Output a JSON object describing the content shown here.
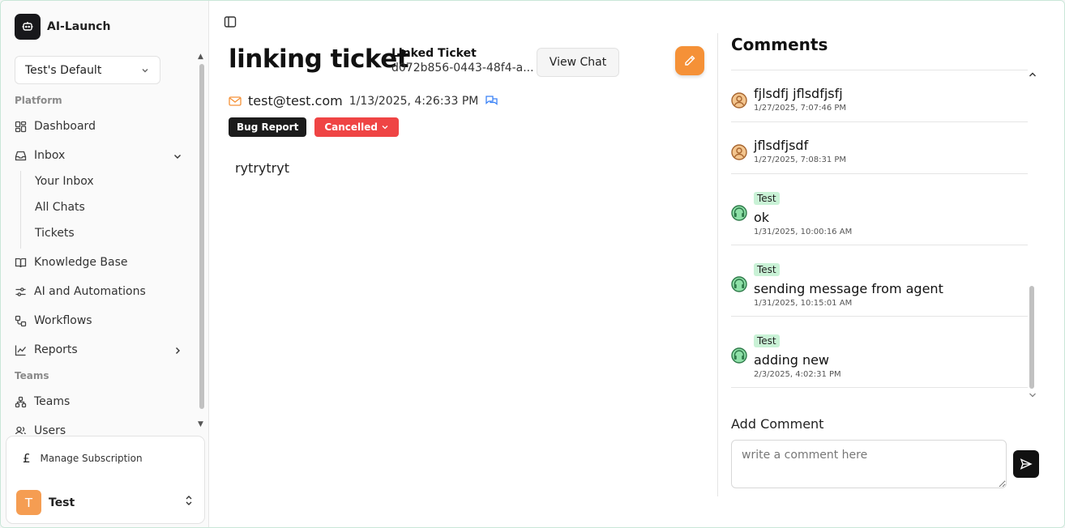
{
  "brand": {
    "name": "AI-Launch"
  },
  "workspace": {
    "label": "Test's Default"
  },
  "sidebar": {
    "platform_label": "Platform",
    "teams_label": "Teams",
    "items": {
      "dashboard": "Dashboard",
      "inbox": "Inbox",
      "your_inbox": "Your Inbox",
      "all_chats": "All Chats",
      "tickets": "Tickets",
      "knowledge_base": "Knowledge Base",
      "ai_automations": "AI and Automations",
      "workflows": "Workflows",
      "reports": "Reports",
      "teams": "Teams",
      "users": "Users"
    }
  },
  "footer": {
    "manage_subscription": "Manage Subscription",
    "user_initial": "T",
    "user_name": "Test"
  },
  "ticket": {
    "title": "linking ticket",
    "linked_label": "Linked Ticket",
    "linked_id": "d072b856-0443-48f4-a...",
    "view_chat": "View Chat",
    "email": "test@test.com",
    "date": "1/13/2025, 4:26:33 PM",
    "type_tag": "Bug Report",
    "status": "Cancelled",
    "body": "rytrytryt"
  },
  "comments": {
    "title": "Comments",
    "items": [
      {
        "author_badge": "",
        "text": "fjlsdfj jflsdfjsfj",
        "time": "1/27/2025, 7:07:46 PM",
        "avatar": "user-face-icon"
      },
      {
        "author_badge": "",
        "text": "jflsdfjsdf",
        "time": "1/27/2025, 7:08:31 PM",
        "avatar": "user-face-icon"
      },
      {
        "author_badge": "Test",
        "text": "ok",
        "time": "1/31/2025, 10:00:16 AM",
        "avatar": "agent-headset-icon"
      },
      {
        "author_badge": "Test",
        "text": "sending message from agent",
        "time": "1/31/2025, 10:15:01 AM",
        "avatar": "agent-headset-icon"
      },
      {
        "author_badge": "Test",
        "text": "adding new",
        "time": "2/3/2025, 4:02:31 PM",
        "avatar": "agent-headset-icon"
      }
    ],
    "add_label": "Add Comment",
    "placeholder": "write a comment here"
  },
  "colors": {
    "accent": "#f59137",
    "status_red": "#ef4444",
    "badge_green": "#c9f2d6"
  }
}
